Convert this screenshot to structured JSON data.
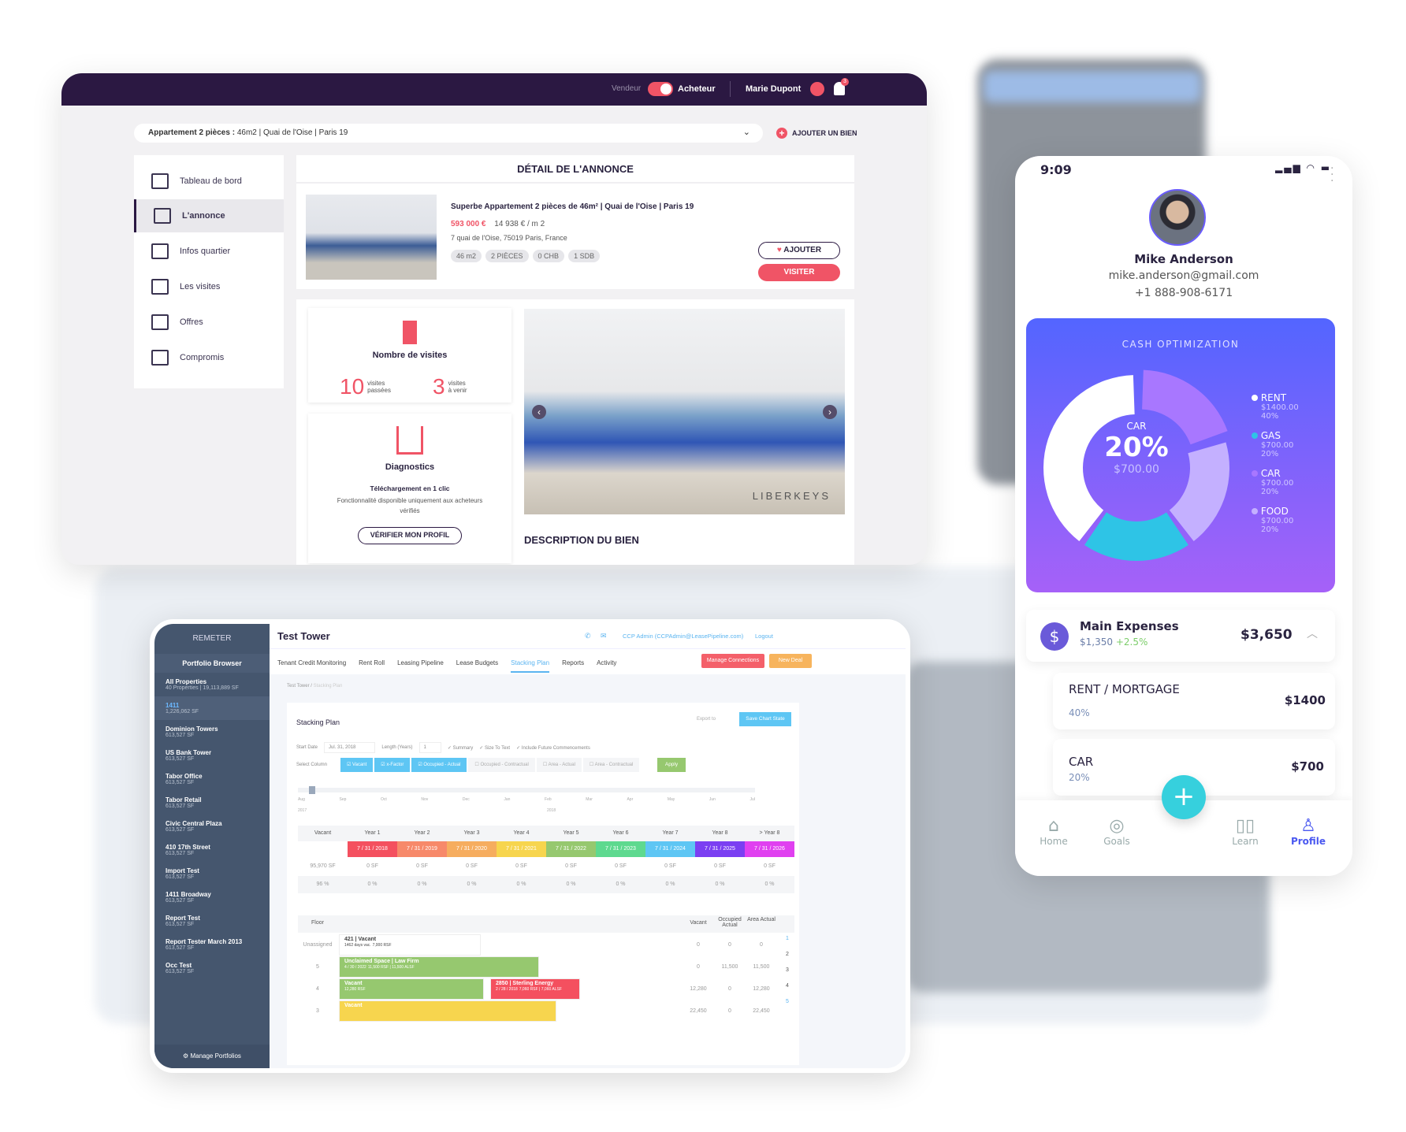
{
  "laptop": {
    "header": {
      "seller_label": "Vendeur",
      "buyer_label": "Acheteur",
      "user_name": "Marie Dupont",
      "notification_count": "3"
    },
    "property_selector": {
      "title": "Appartement 2 pièces :",
      "details": "46m2 | Quai de l'Oise | Paris 19"
    },
    "add_property_label": "AJOUTER UN BIEN",
    "nav": [
      {
        "label": "Tableau de bord"
      },
      {
        "label": "L'annonce"
      },
      {
        "label": "Infos quartier"
      },
      {
        "label": "Les visites"
      },
      {
        "label": "Offres"
      },
      {
        "label": "Compromis"
      }
    ],
    "detail_title": "DÉTAIL DE L'ANNONCE",
    "listing": {
      "title": "Superbe Appartement 2 pièces de 46m² | Quai de l'Oise | Paris 19",
      "price": "593 000 €",
      "price_per_m2": "14 938 € / m 2",
      "address": "7 quai de l'Oise, 75019 Paris, France",
      "chips": [
        "46 m2",
        "2 PIÈCES",
        "0 CHB",
        "1 SDB"
      ],
      "add_label": "AJOUTER",
      "visit_label": "VISITER",
      "watermark": "LIBERKEYS"
    },
    "visits": {
      "title": "Nombre de visites",
      "past_count": "10",
      "past_label_1": "visites",
      "past_label_2": "passées",
      "upcoming_count": "3",
      "upcoming_label_1": "visites",
      "upcoming_label_2": "à venir"
    },
    "diagnostics": {
      "title": "Diagnostics",
      "subtitle": "Téléchargement en 1 clic",
      "text": "Fonctionnalité disponible uniquement aux acheteurs vérifiés",
      "button": "VÉRIFIER MON PROFIL"
    },
    "description_title": "DESCRIPTION DU BIEN"
  },
  "tablet": {
    "logo": "REMETER",
    "sidebar_title": "Portfolio Browser",
    "properties": [
      {
        "name": "All Properties",
        "sub": "40 Properties | 19,113,889 SF"
      },
      {
        "name": "1411",
        "sub": "1,226,062 SF"
      },
      {
        "name": "Dominion Towers",
        "sub": "613,527 SF"
      },
      {
        "name": "US Bank Tower",
        "sub": "613,527 SF"
      },
      {
        "name": "Tabor Office",
        "sub": "613,527 SF"
      },
      {
        "name": "Tabor Retail",
        "sub": "613,527 SF"
      },
      {
        "name": "Civic Central Plaza",
        "sub": "613,527 SF"
      },
      {
        "name": "410 17th Street",
        "sub": "613,527 SF"
      },
      {
        "name": "Import Test",
        "sub": "613,527 SF"
      },
      {
        "name": "1411 Broadway",
        "sub": "613,527 SF"
      },
      {
        "name": "Report Test",
        "sub": "613,527 SF"
      },
      {
        "name": "Report Tester March 2013",
        "sub": "613,527 SF"
      },
      {
        "name": "Occ Test",
        "sub": "613,527 SF"
      }
    ],
    "manage_portfolios": "Manage Portfolios",
    "title": "Test Tower",
    "user": "CCP Admin (CCPAdmin@LeasePipeline.com)",
    "logout": "Logout",
    "tabs": [
      "Tenant Credit Monitoring",
      "Rent Roll",
      "Leasing Pipeline",
      "Lease Budgets",
      "Stacking Plan",
      "Reports",
      "Activity"
    ],
    "active_tab": "Stacking Plan",
    "manage_connections": "Manage Connections",
    "new_deal": "New Deal",
    "breadcrumb": [
      "Test Tower",
      "Stacking Plan"
    ],
    "card_title": "Stacking Plan",
    "export_label": "Export to",
    "save_chart": "Save Chart State",
    "start_date_label": "Start Date",
    "start_date": "Jul. 31, 2018",
    "length_label": "Length (Years)",
    "length": "1",
    "options": [
      "Summary",
      "Size To Text",
      "Include Future Commencements"
    ],
    "select_column_label": "Select Column",
    "columns": [
      {
        "label": "Vacant",
        "on": true
      },
      {
        "label": "x-Factor",
        "on": true
      },
      {
        "label": "Occupied - Actual",
        "on": true
      },
      {
        "label": "Occupied - Contractual",
        "on": false
      },
      {
        "label": "Area - Actual",
        "on": false
      },
      {
        "label": "Area - Contractual",
        "on": false
      }
    ],
    "apply": "Apply",
    "months": [
      "Aug",
      "Sep",
      "Oct",
      "Nov",
      "Dec",
      "Jan",
      "Feb",
      "Mar",
      "Apr",
      "May",
      "Jun",
      "Jul"
    ],
    "years": [
      "2017",
      "2018"
    ],
    "year_headers": [
      "Vacant",
      "Year 1",
      "Year 2",
      "Year 3",
      "Year 4",
      "Year 5",
      "Year 6",
      "Year 7",
      "Year 8",
      "> Year 8"
    ],
    "year_dates": [
      "7 / 31 / 2018",
      "7 / 31 / 2019",
      "7 / 31 / 2020",
      "7 / 31 / 2021",
      "7 / 31 / 2022",
      "7 / 31 / 2023",
      "7 / 31 / 2024",
      "7 / 31 / 2025",
      "7 / 31 / 2026"
    ],
    "year_colors": [
      "#f4505f",
      "#f7896a",
      "#f6ad5f",
      "#f7d54e",
      "#96c86f",
      "#5ed98f",
      "#5ec6f4",
      "#7b3ff2",
      "#e040f0"
    ],
    "sf_row": [
      "95,970 SF",
      "0 SF",
      "0 SF",
      "0 SF",
      "0 SF",
      "0 SF",
      "0 SF",
      "0 SF",
      "0 SF",
      "0 SF"
    ],
    "pct_row": [
      "96 %",
      "0 %",
      "0 %",
      "0 %",
      "0 %",
      "0 %",
      "0 %",
      "0 %",
      "0 %",
      "0 %"
    ],
    "floor_headers": {
      "floor": "Floor",
      "vacant": "Vacant",
      "occupied": "Occupied Actual",
      "area": "Area Actual"
    },
    "floors": [
      {
        "floor": "Unassigned",
        "vacant": "0",
        "occupied": "0",
        "area": "0"
      },
      {
        "floor": "5",
        "vacant": "0",
        "occupied": "11,500",
        "area": "11,500"
      },
      {
        "floor": "4",
        "vacant": "12,280",
        "occupied": "0",
        "area": "12,280"
      },
      {
        "floor": "3",
        "vacant": "22,450",
        "occupied": "0",
        "area": "22,450"
      }
    ],
    "blocks": [
      {
        "title": "421 | Vacant",
        "l1": "1462 days vac.",
        "l2": "7,000 RSF"
      },
      {
        "title": "Unclaimed Space | Law Firm",
        "l1": "4 / 30 / 2022",
        "l2": "11,500 RSF | 11,500 ALSF"
      },
      {
        "title": "Vacant",
        "l1": "",
        "l2": "12,280 RSF"
      },
      {
        "title": "2850 | Sterling Energy",
        "l1": "2 / 28 / 2018",
        "l2": "7,060 RSF | 7,060 ALSF"
      },
      {
        "title": "Vacant",
        "l1": "",
        "l2": ""
      }
    ],
    "pager": [
      "1",
      "2",
      "3",
      "4",
      "5"
    ]
  },
  "phone": {
    "time": "9:09",
    "name": "Mike Anderson",
    "email": "mike.anderson@gmail.com",
    "phone": "+1 888-908-6171",
    "chart_title": "CASH OPTIMIZATION",
    "center": {
      "label": "CAR",
      "value": "20%",
      "amount": "$700.00"
    },
    "slices": [
      {
        "name": "RENT",
        "amount": "$1400.00",
        "pct": "40%",
        "value": 40,
        "color": "#ffffff"
      },
      {
        "name": "GAS",
        "amount": "$700.00",
        "pct": "20%",
        "value": 20,
        "color": "#2ec4e6"
      },
      {
        "name": "CAR",
        "amount": "$700.00",
        "pct": "20%",
        "value": 20,
        "color": "#a877ff"
      },
      {
        "name": "FOOD",
        "amount": "$700.00",
        "pct": "20%",
        "value": 20,
        "color": "#c4b0ff"
      }
    ],
    "main_expenses": {
      "title": "Main Expenses",
      "amount": "$1,350",
      "change": "+2.5%",
      "total": "$3,650"
    },
    "expenses": [
      {
        "name": "RENT / MORTGAGE",
        "pct": "40%",
        "amount": "$1400"
      },
      {
        "name": "CAR",
        "pct": "20%",
        "amount": "$700"
      }
    ],
    "tabs": [
      {
        "label": "Home"
      },
      {
        "label": "Goals"
      },
      {
        "label": "Learn"
      },
      {
        "label": "Profile"
      }
    ],
    "active_tab": "Profile"
  }
}
